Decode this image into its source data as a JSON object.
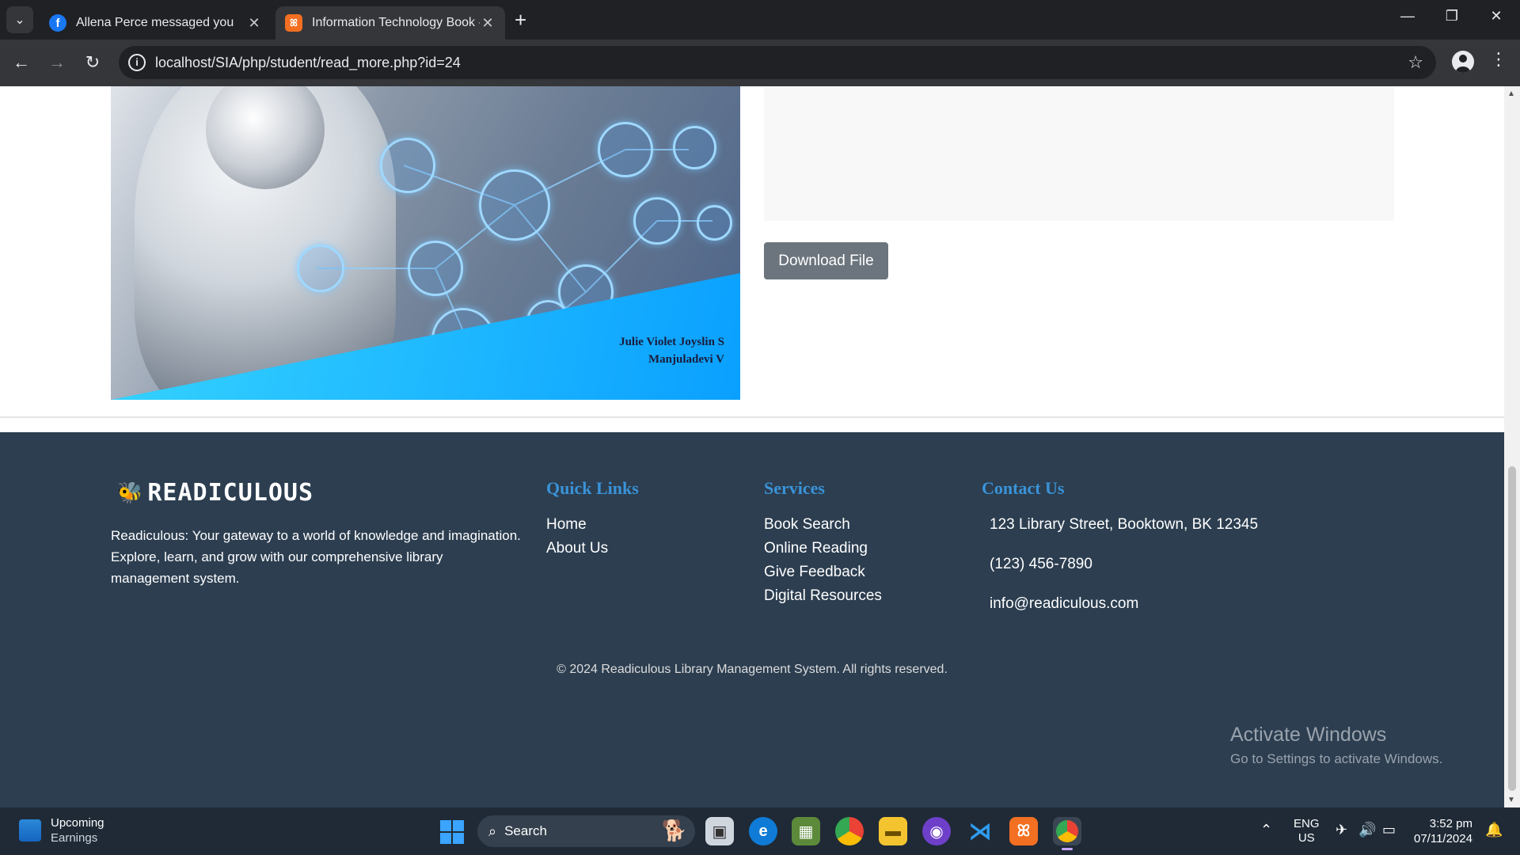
{
  "browser": {
    "tabs": [
      {
        "title": "Allena Perce messaged you",
        "favicon": "facebook-icon",
        "active": false
      },
      {
        "title": "Information Technology Book -",
        "favicon": "xampp-icon",
        "active": true
      }
    ],
    "new_tab_label": "+",
    "url": "localhost/SIA/php/student/read_more.php?id=24"
  },
  "book": {
    "cover_authors_line1": "Julie Violet Joyslin  S",
    "cover_authors_line2": "Manjuladevi  V",
    "download_label": "Download File"
  },
  "footer": {
    "brand_name": "READICULOUS",
    "brand_description": "Readiculous: Your gateway to a world of knowledge and imagination. Explore, learn, and grow with our comprehensive library management system.",
    "quick_links": {
      "heading": "Quick Links",
      "items": [
        "Home",
        "About Us"
      ]
    },
    "services": {
      "heading": "Services",
      "items": [
        "Book Search",
        "Online Reading",
        "Give Feedback",
        "Digital Resources"
      ]
    },
    "contact": {
      "heading": "Contact Us",
      "address": "123 Library Street, Booktown, BK 12345",
      "phone": "(123) 456-7890",
      "email": "info@readiculous.com"
    },
    "copyright": "© 2024 Readiculous Library Management System. All rights reserved.",
    "colors": {
      "background": "#2c3e50",
      "heading": "#3a93d8"
    }
  },
  "watermark": {
    "line1": "Activate Windows",
    "line2": "Go to Settings to activate Windows."
  },
  "taskbar": {
    "weather_title": "Upcoming",
    "weather_sub": "Earnings",
    "search_label": "Search",
    "lang_line1": "ENG",
    "lang_line2": "US",
    "time": "3:52 pm",
    "date": "07/11/2024"
  }
}
